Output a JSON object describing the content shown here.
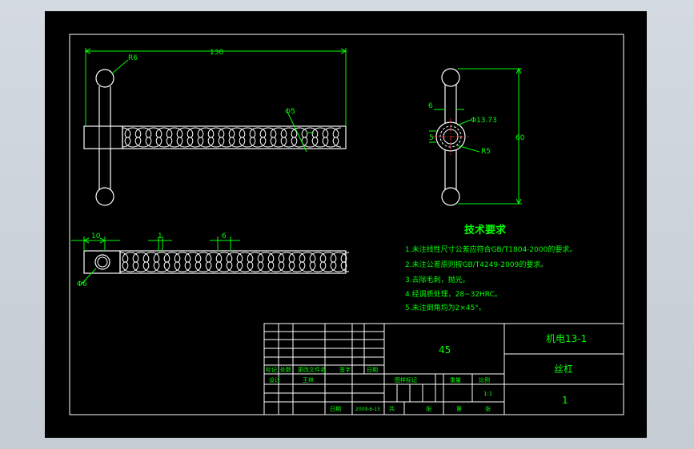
{
  "colors": {
    "background": "#000000",
    "outline": "#ffffff",
    "dimension": "#00ff00",
    "center": "#ff3333",
    "title_text": "#00ff00"
  },
  "dimensions": {
    "overall_length": "130",
    "ball_radius_top": "R6",
    "thread_dia": "Φ5",
    "side_width": "6",
    "side_dia": "Φ13.73",
    "side_height": "5",
    "side_radius": "R5",
    "total_height": "60",
    "front_offset": "10",
    "front_pitch": "1",
    "front_width": "6",
    "hole_dia": "Φ6"
  },
  "tech": {
    "title": "技术要求",
    "items": [
      "1.未注线性尺寸公差应符合GB/T1804-2000的要求。",
      "2.未注公差原则按GB/T4249-2009的要求。",
      "3.去除毛刺，抛光。",
      "4.经调质处理，28~32HRC。",
      "5.未注倒角均为2×45°。"
    ]
  },
  "title_block": {
    "material": "45",
    "project": "机电13-1",
    "part_name": "丝杠",
    "quantity": "1",
    "headers": {
      "mark": "标记",
      "count": "处数",
      "doc": "更改文件名",
      "sign": "签字",
      "date": "日期",
      "design": "设计",
      "designer": "王林",
      "date2": "日期",
      "date_value": "2009-6-15",
      "stage_mark": "图样标记",
      "weight": "重量",
      "scale": "比例",
      "scale_value": "1:1",
      "total": "共",
      "sheet_unit": "张",
      "sheet_no": "第",
      "sheet_unit2": "张"
    }
  }
}
